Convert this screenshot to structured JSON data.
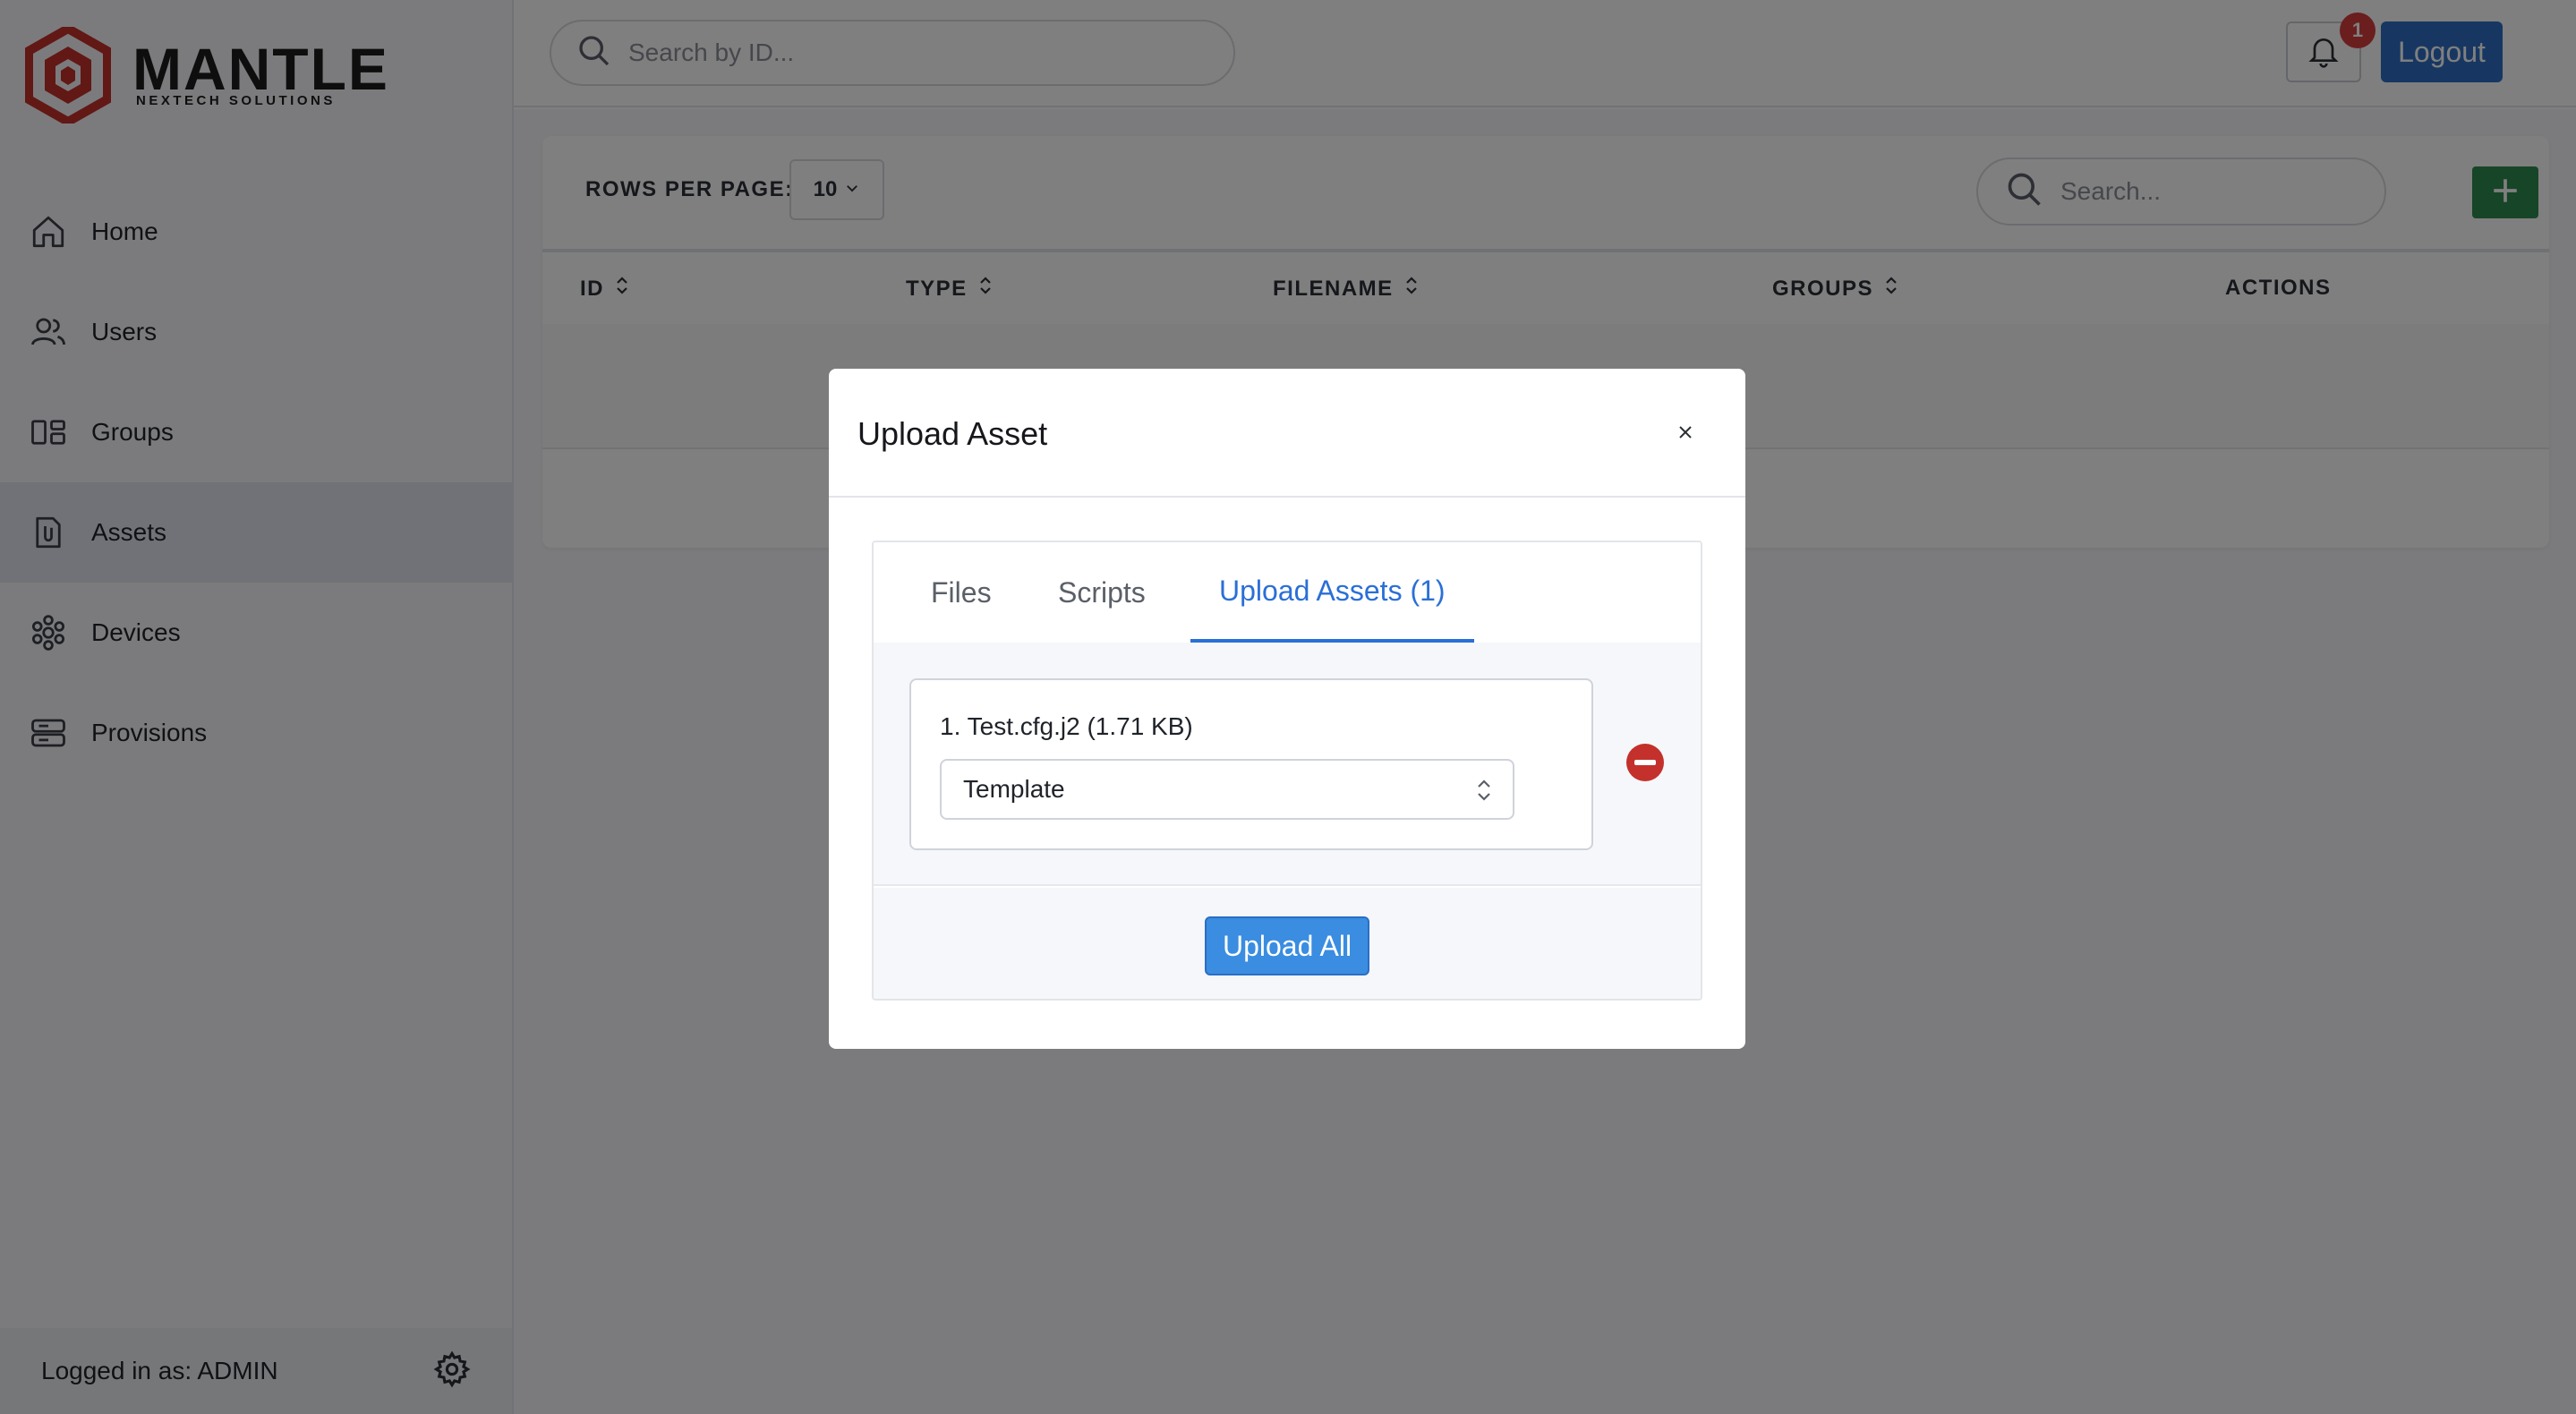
{
  "brand": {
    "name": "MANTLE",
    "tagline": "NEXTECH SOLUTIONS",
    "color": "#c4302b"
  },
  "sidebar": {
    "items": [
      {
        "label": "Home",
        "icon": "home-icon"
      },
      {
        "label": "Users",
        "icon": "users-icon"
      },
      {
        "label": "Groups",
        "icon": "groups-icon"
      },
      {
        "label": "Assets",
        "icon": "paperclip-document-icon",
        "active": true
      },
      {
        "label": "Devices",
        "icon": "devices-icon"
      },
      {
        "label": "Provisions",
        "icon": "server-stack-icon"
      }
    ],
    "footer": {
      "logged_in": "Logged in as: ADMIN",
      "settings_icon": "gear-icon"
    }
  },
  "topbar": {
    "search_placeholder": "Search by ID...",
    "notifications_count": "1",
    "logout_label": "Logout"
  },
  "table": {
    "rows_per_page_label": "ROWS PER PAGE:",
    "rows_per_page_value": "10",
    "search_placeholder": "Search...",
    "add_icon": "plus-icon",
    "columns": [
      "ID",
      "TYPE",
      "FILENAME",
      "GROUPS",
      "ACTIONS"
    ]
  },
  "modal": {
    "title": "Upload Asset",
    "close_icon": "close-icon",
    "tabs": [
      "Files",
      "Scripts",
      "Upload Assets (1)"
    ],
    "active_tab": "Upload Assets (1)",
    "assets": [
      {
        "name": "1. Test.cfg.j2 (1.71 KB)",
        "type": "Template"
      }
    ],
    "upload_all_label": "Upload All"
  },
  "colors": {
    "primary": "#2e6fc4",
    "active_tab": "#2a6fd6",
    "add_button": "#2f8a4e",
    "remove_button": "#c4302b",
    "badge": "#d63c3c"
  }
}
